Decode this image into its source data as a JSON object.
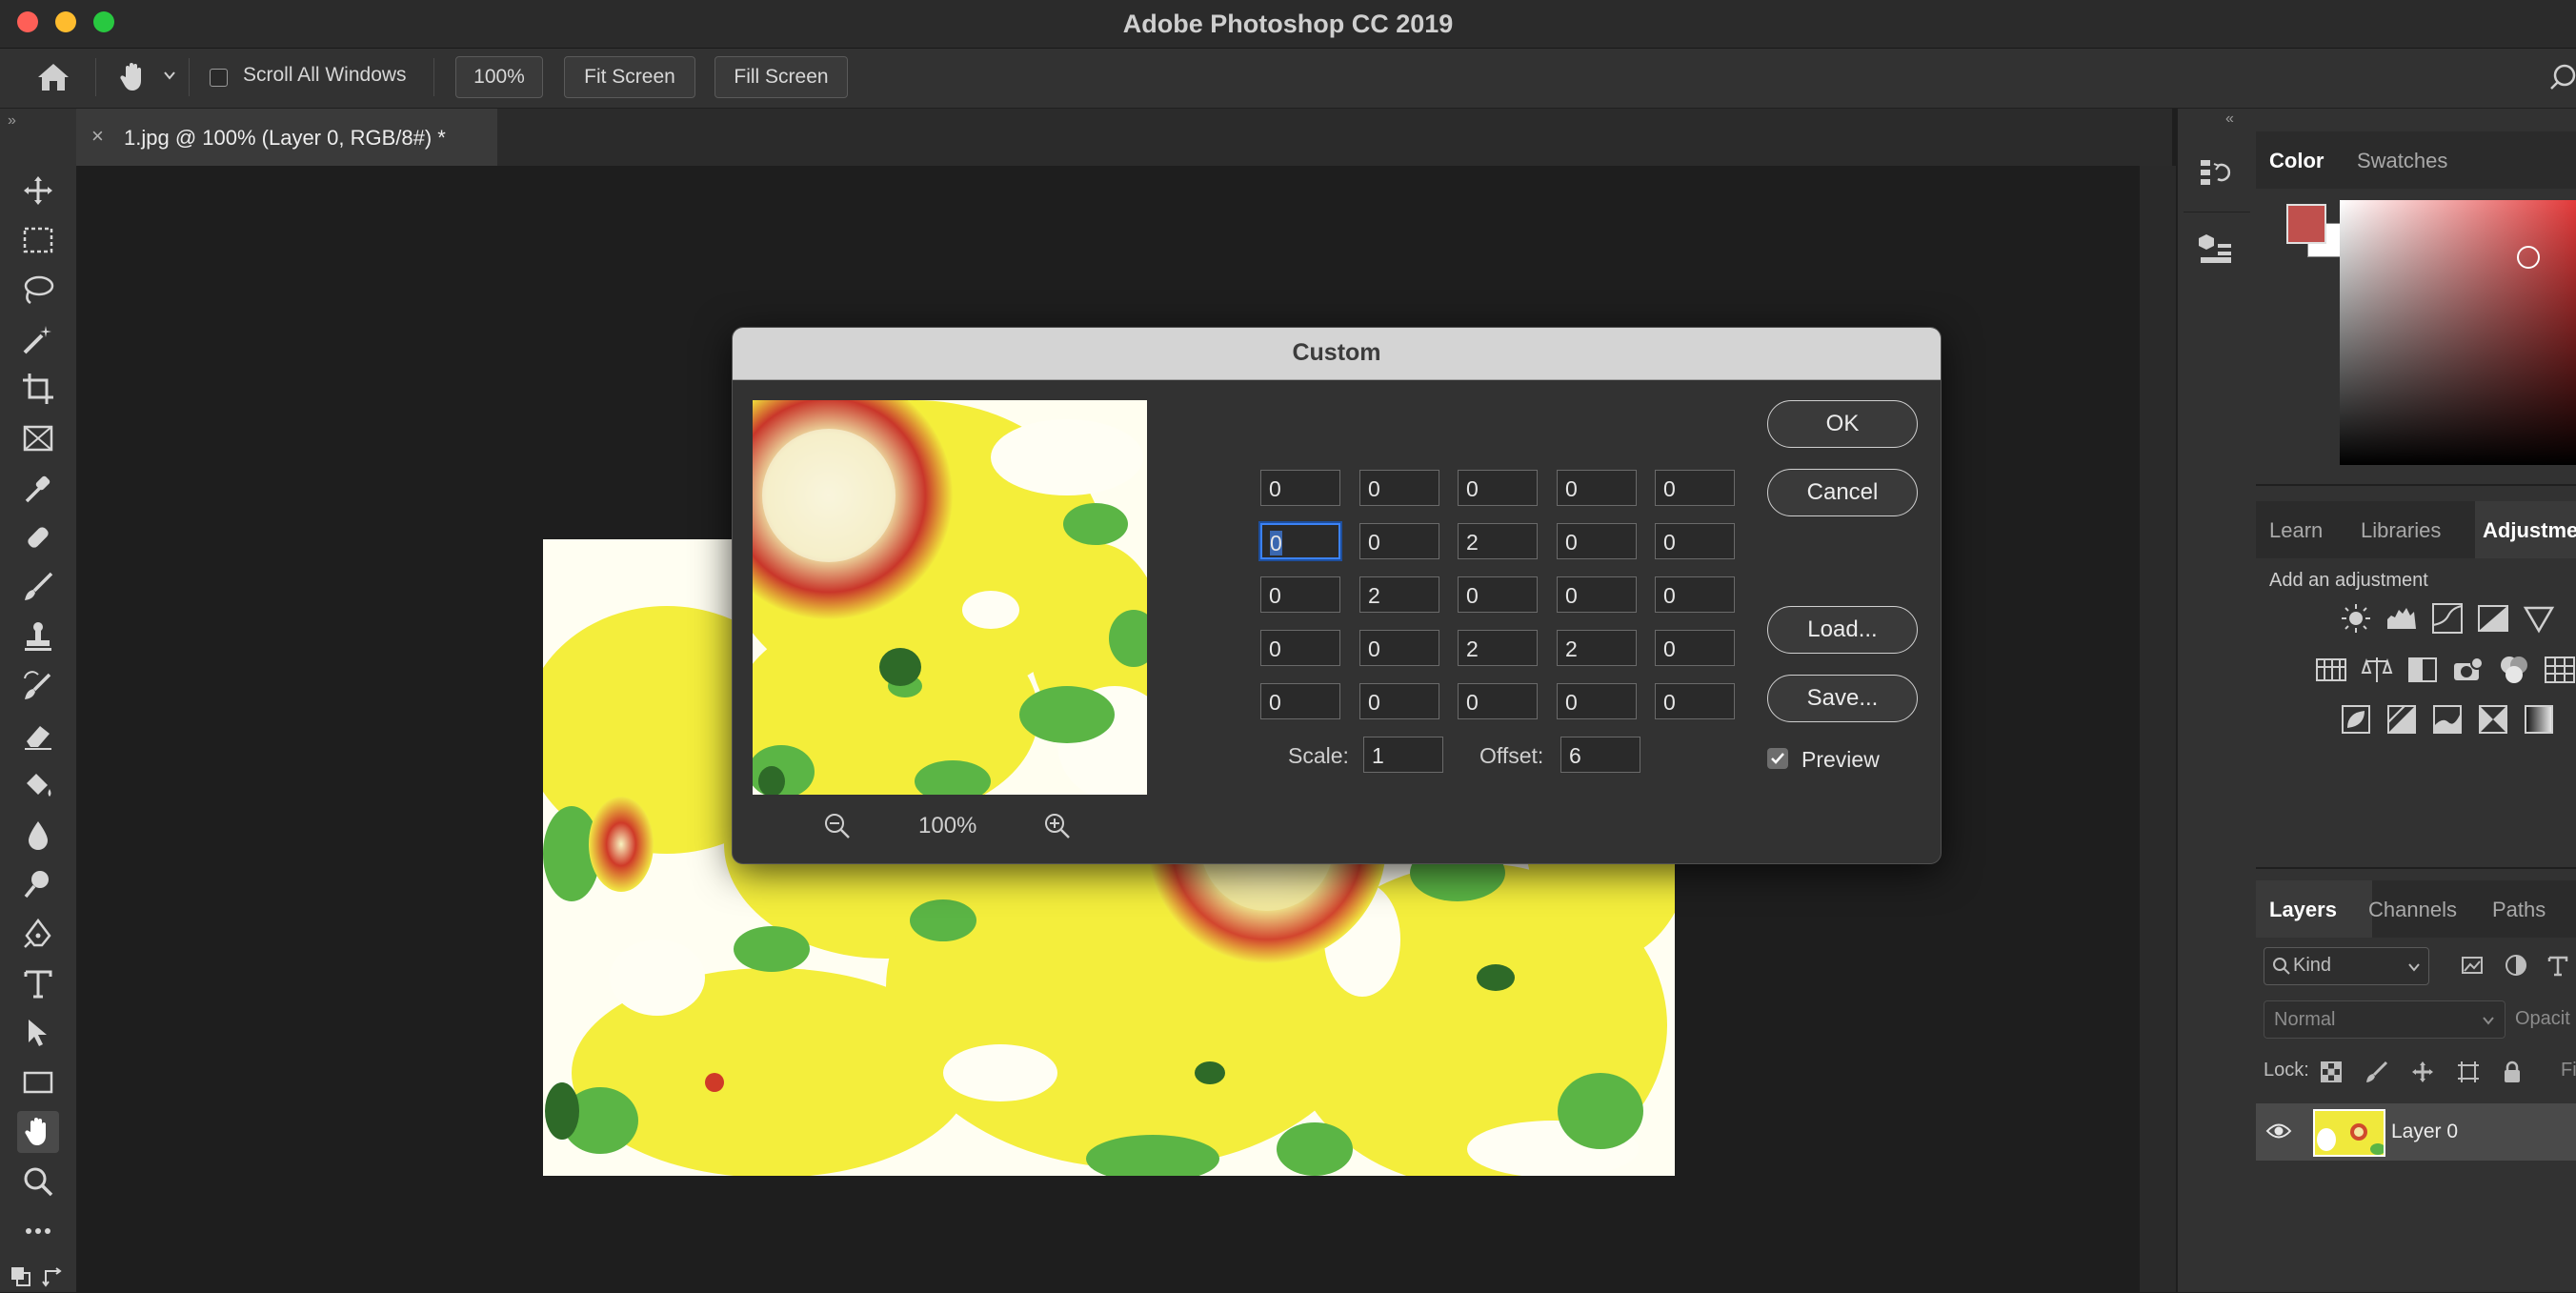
{
  "app": {
    "title": "Adobe Photoshop CC 2019"
  },
  "options_bar": {
    "scroll_all_windows_label": "Scroll All Windows",
    "scroll_all_windows_checked": false,
    "zoom_100_label": "100%",
    "fit_screen_label": "Fit Screen",
    "fill_screen_label": "Fill Screen"
  },
  "document_tab": {
    "label": "1.jpg @ 100% (Layer 0, RGB/8#) *",
    "close": "×"
  },
  "tools": [
    "move-icon",
    "marquee-icon",
    "lasso-icon",
    "magic-wand-icon",
    "crop-icon",
    "frame-icon",
    "eyedropper-icon",
    "healing-brush-icon",
    "brush-icon",
    "stamp-icon",
    "history-brush-icon",
    "eraser-icon",
    "paint-bucket-icon",
    "blur-icon",
    "dodge-icon",
    "pen-icon",
    "type-icon",
    "path-select-icon",
    "rectangle-icon",
    "hand-icon",
    "zoom-icon",
    "more-icon"
  ],
  "dialog": {
    "title": "Custom",
    "matrix": [
      [
        "0",
        "0",
        "0",
        "0",
        "0"
      ],
      [
        "0",
        "0",
        "2",
        "0",
        "0"
      ],
      [
        "0",
        "2",
        "0",
        "0",
        "0"
      ],
      [
        "0",
        "0",
        "2",
        "2",
        "0"
      ],
      [
        "0",
        "0",
        "0",
        "0",
        "0"
      ]
    ],
    "scale_label": "Scale:",
    "scale_value": "1",
    "offset_label": "Offset:",
    "offset_value": "6",
    "preview_zoom": "100%",
    "ok_label": "OK",
    "cancel_label": "Cancel",
    "load_label": "Load...",
    "save_label": "Save...",
    "preview_label": "Preview",
    "preview_checked": true
  },
  "color_panel": {
    "tabs": [
      "Color",
      "Swatches"
    ],
    "foreground": "#c0504d",
    "background": "#ffffff"
  },
  "adjustments_panel": {
    "tabs": [
      "Learn",
      "Libraries",
      "Adjustme"
    ],
    "subtitle": "Add an adjustment"
  },
  "layers_panel": {
    "tabs": [
      "Layers",
      "Channels",
      "Paths"
    ],
    "filter_kind": "Kind",
    "blend_mode": "Normal",
    "opacity_label": "Opacit",
    "lock_label": "Lock:",
    "fill_label": "Fi",
    "layers": [
      {
        "name": "Layer 0",
        "visible": true
      }
    ]
  },
  "colors": {
    "accent": "#3b82f6",
    "sunflower_yellow": "#f5ef3a",
    "sunflower_red": "#c9362a"
  }
}
